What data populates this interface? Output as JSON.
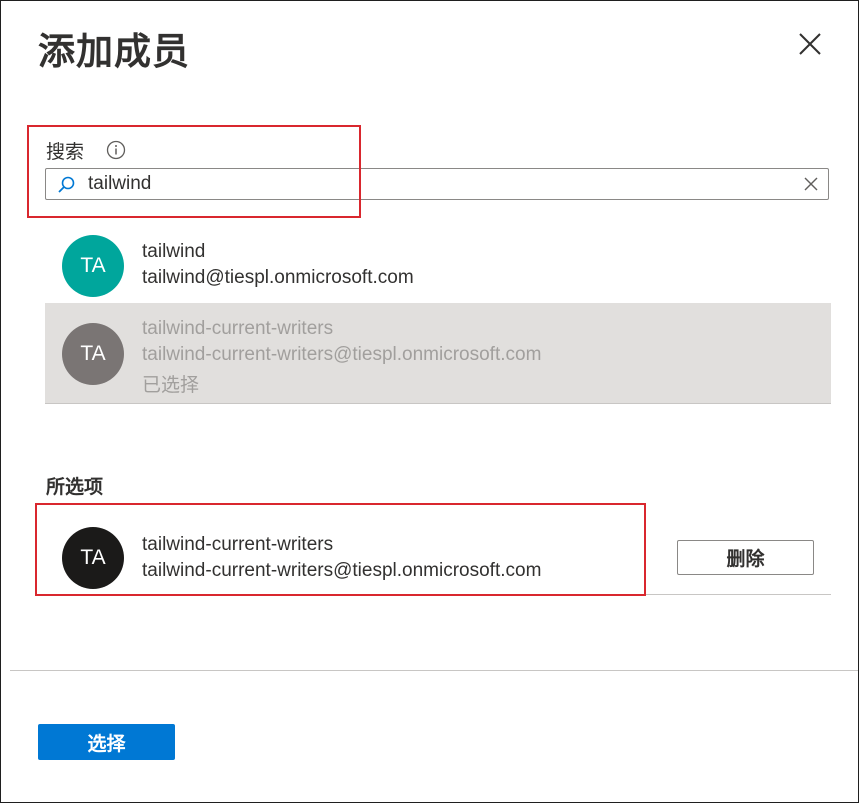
{
  "dialog": {
    "title": "添加成员",
    "close_icon": "close-icon"
  },
  "search": {
    "label": "搜索",
    "info_icon": "info-icon",
    "value": "tailwind",
    "search_icon": "search-icon",
    "clear_icon": "clear-icon"
  },
  "results": [
    {
      "initials": "TA",
      "name": "tailwind",
      "email": "tailwind@tiespl.onmicrosoft.com",
      "avatar_color": "#00a69c",
      "selected": false
    },
    {
      "initials": "TA",
      "name": "tailwind-current-writers",
      "email": "tailwind-current-writers@tiespl.onmicrosoft.com",
      "status": "已选择",
      "avatar_color": "#7a7574",
      "selected": true
    }
  ],
  "selected_section": {
    "label": "所选项",
    "items": [
      {
        "initials": "TA",
        "name": "tailwind-current-writers",
        "email": "tailwind-current-writers@tiespl.onmicrosoft.com",
        "avatar_color": "#1b1a19",
        "remove_label": "删除"
      }
    ]
  },
  "footer": {
    "select_label": "选择"
  },
  "colors": {
    "accent": "#0078d4",
    "highlight_border": "#d9272e",
    "selected_row_bg": "#e1dfdd"
  }
}
